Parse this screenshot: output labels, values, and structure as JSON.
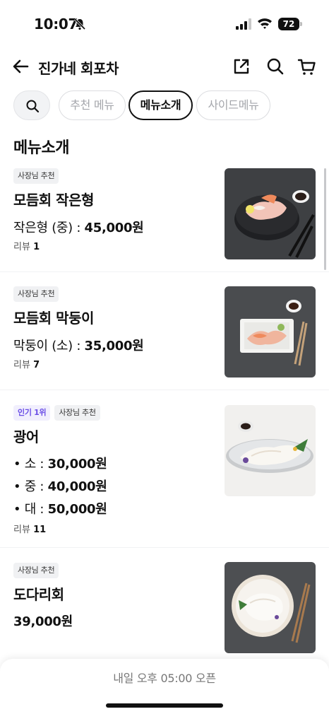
{
  "status_bar": {
    "time": "10:07",
    "battery": "72"
  },
  "header": {
    "title": "진가네 회포차"
  },
  "tabs": [
    {
      "label": "추천 메뉴",
      "active": false
    },
    {
      "label": "메뉴소개",
      "active": true
    },
    {
      "label": "사이드메뉴",
      "active": false
    }
  ],
  "section_title": "메뉴소개",
  "items": [
    {
      "badges": [
        "사장님 추천"
      ],
      "name": "모듬회 작은형",
      "price_prefix": "작은형 (중) : ",
      "price": "45,000원",
      "review_label": "리뷰 ",
      "review_count": "1"
    },
    {
      "badges": [
        "사장님 추천"
      ],
      "name": "모듬회 막둥이",
      "price_prefix": "막둥이 (소) : ",
      "price": "35,000원",
      "review_label": "리뷰 ",
      "review_count": "7"
    },
    {
      "badges": [
        "인기 1위",
        "사장님 추천"
      ],
      "name": "광어",
      "prices": [
        {
          "prefix": "• 소 : ",
          "value": "30,000원"
        },
        {
          "prefix": "• 중 : ",
          "value": "40,000원"
        },
        {
          "prefix": "• 대 : ",
          "value": "50,000원"
        }
      ],
      "review_label": "리뷰 ",
      "review_count": "11"
    },
    {
      "badges": [
        "사장님 추천"
      ],
      "name": "도다리회",
      "price": "39,000원"
    }
  ],
  "bottom_bar": {
    "open_info": "내일 오후 05:00 오픈"
  },
  "colors": {
    "accent_purple": "#6a4ee6",
    "badge_bg": "#f0f1f3"
  }
}
